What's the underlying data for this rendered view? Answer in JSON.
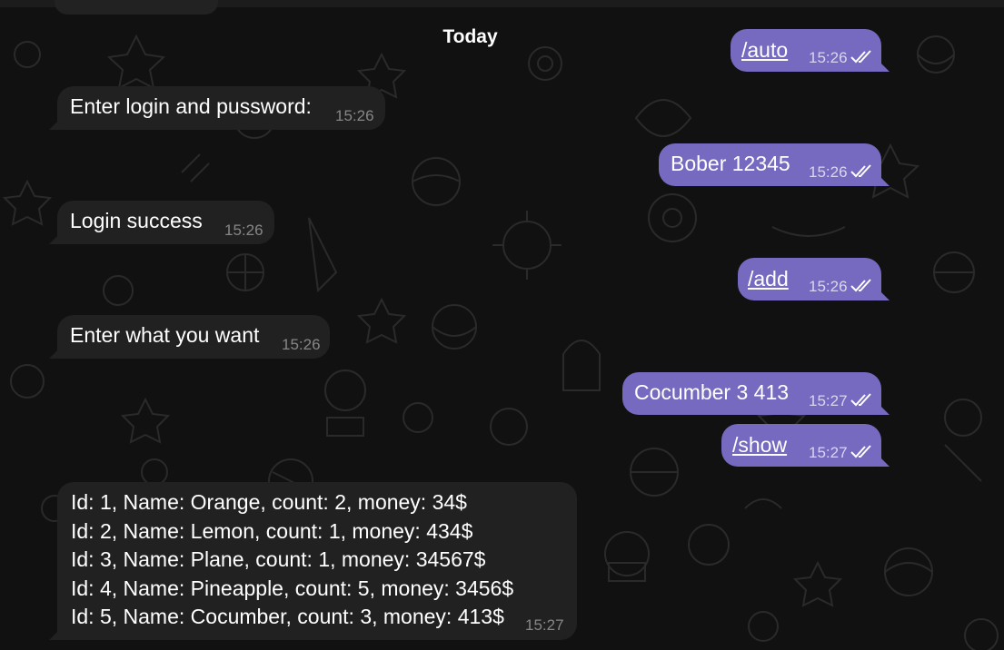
{
  "date_separator": "Today",
  "messages": [
    {
      "direction": "outgoing",
      "text": "/auto",
      "time": "15:26",
      "read": true,
      "is_command": true
    },
    {
      "direction": "incoming",
      "text": "Enter login and pussword:",
      "time": "15:26"
    },
    {
      "direction": "outgoing",
      "text": "Bober 12345",
      "time": "15:26",
      "read": true,
      "is_command": false
    },
    {
      "direction": "incoming",
      "text": "Login success",
      "time": "15:26"
    },
    {
      "direction": "outgoing",
      "text": "/add",
      "time": "15:26",
      "read": true,
      "is_command": true
    },
    {
      "direction": "incoming",
      "text": "Enter what you want",
      "time": "15:26"
    },
    {
      "direction": "outgoing",
      "text": "Cocumber 3 413",
      "time": "15:27",
      "read": true,
      "is_command": false
    },
    {
      "direction": "outgoing",
      "text": "/show",
      "time": "15:27",
      "read": true,
      "is_command": true
    },
    {
      "direction": "incoming",
      "lines": [
        "Id: 1, Name: Orange, count: 2, money: 34$",
        "Id: 2, Name: Lemon, count: 1, money: 434$",
        "Id: 3, Name: Plane, count: 1, money: 34567$",
        "Id: 4, Name: Pineapple, count: 5, money: 3456$",
        "Id: 5, Name: Cocumber, count: 3, money: 413$"
      ],
      "time": "15:27"
    }
  ],
  "colors": {
    "background": "#111111",
    "incoming_bubble": "#212121",
    "outgoing_bubble": "#7569c0",
    "text": "#ffffff"
  },
  "icons": {
    "read_receipt": "double-check-icon",
    "wallpaper": "doodle-pattern"
  }
}
